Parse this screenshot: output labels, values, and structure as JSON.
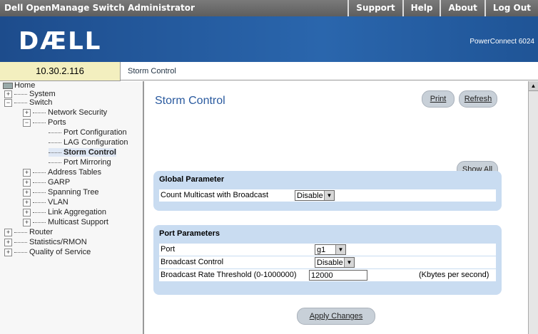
{
  "app": {
    "title": "Dell OpenManage Switch Administrator",
    "links": [
      "Support",
      "Help",
      "About",
      "Log Out"
    ],
    "logo": "DÆLL",
    "product": "PowerConnect 6024"
  },
  "ip": "10.30.2.116",
  "breadcrumb": "Storm Control",
  "tree": [
    {
      "label": "Home",
      "level": 0,
      "ex": ""
    },
    {
      "label": "System",
      "level": 1,
      "ex": "+"
    },
    {
      "label": "Switch",
      "level": 1,
      "ex": "-"
    },
    {
      "label": "Network Security",
      "level": 2,
      "ex": "+"
    },
    {
      "label": "Ports",
      "level": 2,
      "ex": "-"
    },
    {
      "label": "Port Configuration",
      "level": 3,
      "ex": ""
    },
    {
      "label": "LAG Configuration",
      "level": 3,
      "ex": ""
    },
    {
      "label": "Storm Control",
      "level": 3,
      "ex": "",
      "selected": true
    },
    {
      "label": "Port Mirroring",
      "level": 3,
      "ex": ""
    },
    {
      "label": "Address Tables",
      "level": 2,
      "ex": "+"
    },
    {
      "label": "GARP",
      "level": 2,
      "ex": "+"
    },
    {
      "label": "Spanning Tree",
      "level": 2,
      "ex": "+"
    },
    {
      "label": "VLAN",
      "level": 2,
      "ex": "+"
    },
    {
      "label": "Link Aggregation",
      "level": 2,
      "ex": "+"
    },
    {
      "label": "Multicast Support",
      "level": 2,
      "ex": "+"
    },
    {
      "label": "Router",
      "level": 1,
      "ex": "+"
    },
    {
      "label": "Statistics/RMON",
      "level": 1,
      "ex": "+"
    },
    {
      "label": "Quality of Service",
      "level": 1,
      "ex": "+"
    }
  ],
  "main": {
    "title": "Storm Control",
    "buttons": {
      "print": "Print",
      "refresh": "Refresh",
      "show_all": "Show All",
      "apply": "Apply Changes"
    },
    "global": {
      "title": "Global Parameter",
      "count_label": "Count Multicast with Broadcast",
      "count_value": "Disable"
    },
    "port": {
      "title": "Port Parameters",
      "port_label": "Port",
      "port_value": "g1",
      "bc_label": "Broadcast Control",
      "bc_value": "Disable",
      "rate_label": "Broadcast Rate Threshold (0-1000000)",
      "rate_value": "12000",
      "rate_unit": "(Kbytes per second)"
    }
  }
}
